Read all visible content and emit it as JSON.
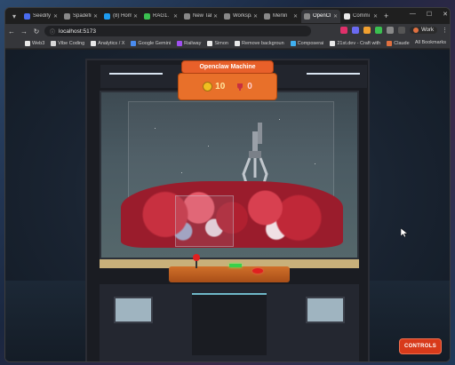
{
  "browser": {
    "tabs": [
      {
        "label": "Seedify",
        "color": "#4a6cf0"
      },
      {
        "label": "Spadefire",
        "color": "#888888"
      },
      {
        "label": "(8) Hom",
        "color": "#1d9bf0"
      },
      {
        "label": "RAG1.",
        "color": "#3ac050"
      },
      {
        "label": "New Tab",
        "color": "#888888"
      },
      {
        "label": "Workspa",
        "color": "#888888"
      },
      {
        "label": "Merlin",
        "color": "#888888"
      },
      {
        "label": "OpenCl",
        "color": "#888888",
        "active": true
      },
      {
        "label": "Commi",
        "color": "#e8e8e8"
      }
    ],
    "url": "localhost:5173",
    "profile_label": "Work",
    "bookmarks": [
      {
        "label": "Web3",
        "color": "#e8e8e8"
      },
      {
        "label": "Vibe Coding",
        "color": "#d8d8d8"
      },
      {
        "label": "Analytics / X",
        "color": "#e8e8e8"
      },
      {
        "label": "Google Gemini",
        "color": "#4a8cf0"
      },
      {
        "label": "Railway",
        "color": "#a050f0"
      },
      {
        "label": "Simon",
        "color": "#e8e8e8"
      },
      {
        "label": "Remove backgroun",
        "color": "#e8e8e8"
      },
      {
        "label": "Composerai",
        "color": "#40b0f0"
      },
      {
        "label": "21st.dev - Craft with",
        "color": "#e8e8e8"
      },
      {
        "label": "Claude",
        "color": "#e07040"
      }
    ],
    "all_bookmarks": "All Bookmarks"
  },
  "game": {
    "title": "Openclaw Machine",
    "coins": "10",
    "prizes": "0",
    "controls_label": "CONTROLS",
    "colors": {
      "plate": "#e8702a",
      "controls_button": "#d83a1a",
      "prize_pile": "#c83040"
    }
  }
}
